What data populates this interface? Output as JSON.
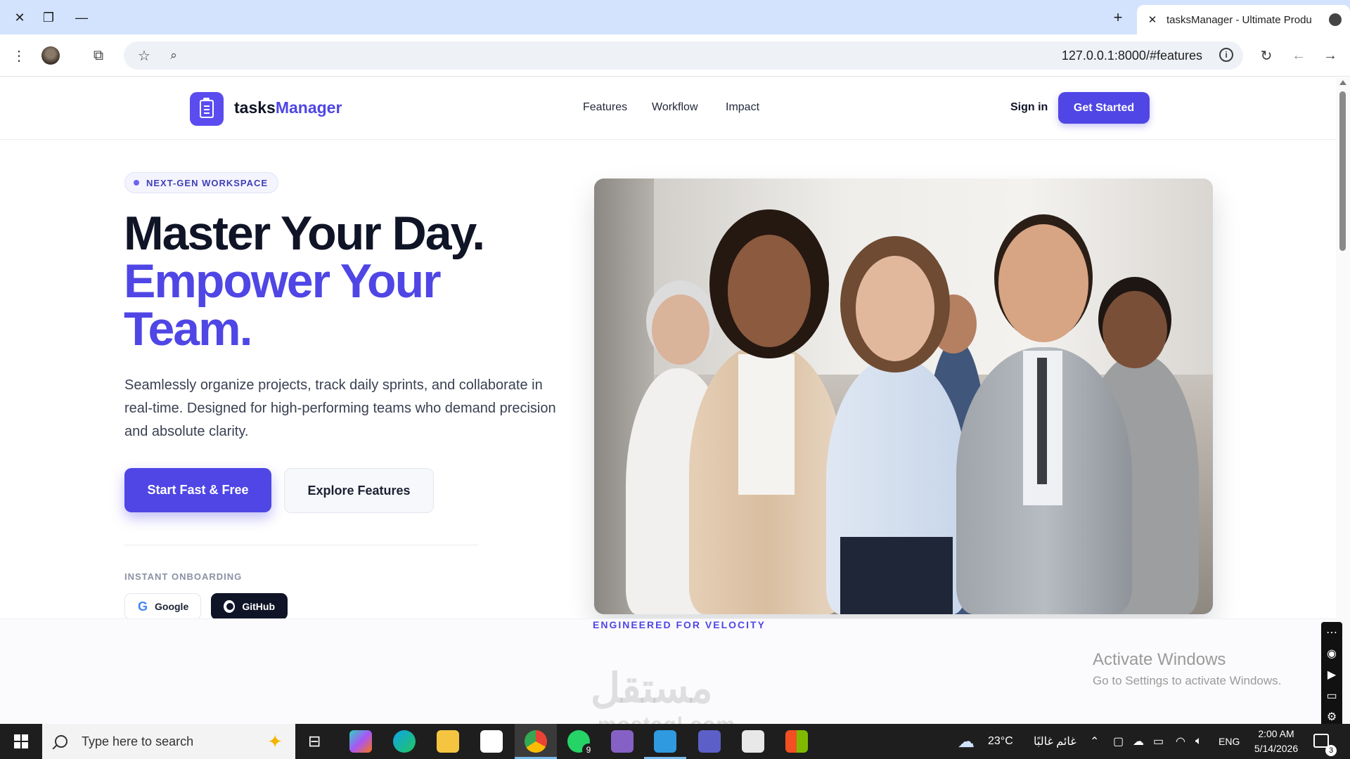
{
  "browser": {
    "tab_title": "tasksManager - Ultimate Produ",
    "url": "127.0.0.1:8000/#features",
    "new_tab_label": "+"
  },
  "site": {
    "brand_plain": "tasks",
    "brand_accent": "Manager",
    "nav": [
      "Features",
      "Workflow",
      "Impact"
    ],
    "sign_in": "Sign in",
    "get_started": "Get Started",
    "badge": "NEXT-GEN WORKSPACE",
    "headline_line1": "Master Your Day.",
    "headline_line2": "Empower Your",
    "headline_line3": "Team.",
    "lead": "Seamlessly organize projects, track daily sprints, and collaborate in real-time. Designed for high-performing teams who demand precision and absolute clarity.",
    "cta_primary": "Start Fast & Free",
    "cta_secondary": "Explore Features",
    "onboarding_label": "INSTANT ONBOARDING",
    "sso_google": "Google",
    "sso_github": "GitHub",
    "section_label": "ENGINEERED FOR VELOCITY",
    "accent_color": "#4f46e5"
  },
  "overlay": {
    "activate_title": "Activate Windows",
    "activate_sub": "Go to Settings to activate Windows.",
    "watermark": "مستقل",
    "watermark_sub": "mostaql.com"
  },
  "taskbar": {
    "search_placeholder": "Type here to search",
    "whatsapp_badge": "9",
    "weather": "23°C",
    "weather_text": "غائم غالبًا",
    "language": "ENG",
    "time": "2:00 AM",
    "date": "5/14/2026",
    "notification_count": "3"
  }
}
